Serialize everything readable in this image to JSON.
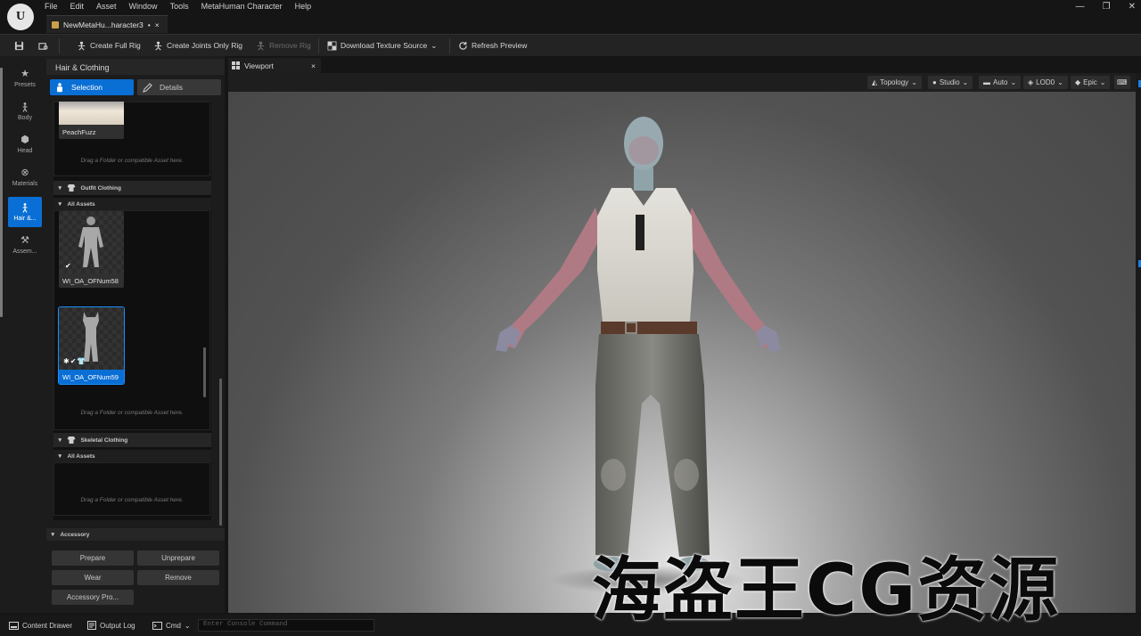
{
  "app": {
    "title": "NewMetaHu...haracter3",
    "tab_suffix": "•",
    "tab_close": "×",
    "logo_text": "U"
  },
  "menu": [
    "File",
    "Edit",
    "Asset",
    "Window",
    "Tools",
    "MetaHuman Character",
    "Help"
  ],
  "window_controls": [
    "—",
    "❐",
    "✕"
  ],
  "toolbar": {
    "create_full_rig": "Create Full Rig",
    "create_joints_only_rig": "Create Joints Only Rig",
    "remove_rig": "Remove Rig",
    "download_texture_source": "Download Texture Source",
    "refresh_preview": "Refresh Preview"
  },
  "sidebar": {
    "items": [
      {
        "label": "Presets",
        "icon": "star-icon",
        "glyph": "★"
      },
      {
        "label": "Body",
        "icon": "body-icon",
        "glyph": "🯅"
      },
      {
        "label": "Head",
        "icon": "head-icon",
        "glyph": "⬢"
      },
      {
        "label": "Materials",
        "icon": "materials-icon",
        "glyph": "⊗"
      },
      {
        "label": "Hair &...",
        "icon": "hair-clothing-icon",
        "glyph": "🯅"
      },
      {
        "label": "Assem...",
        "icon": "hammer-icon",
        "glyph": "⚒"
      }
    ]
  },
  "panel": {
    "title": "Hair & Clothing",
    "mode_selection": "Selection",
    "mode_details": "Details",
    "peach_fuzz": "PeachFuzz",
    "drag_hint": "Drag a Folder or compatible Asset here.",
    "outfit_clothing": "Outfit Clothing",
    "all_assets": "All Assets",
    "outfit_tiles": [
      "WI_OA_OFNum58",
      "WI_OA_OFNum59"
    ],
    "skeletal_clothing": "Skeletal Clothing",
    "accessory": "Accessory",
    "accessory_buttons": [
      "Prepare",
      "Unprepare",
      "Wear",
      "Remove",
      "Accessory Pro..."
    ]
  },
  "viewport": {
    "tab_label": "Viewport",
    "tab_close": "×",
    "topology": "Topology",
    "studio": "Studio",
    "auto": "Auto",
    "lod": "LOD0",
    "quality": "Epic",
    "caret": "⌄"
  },
  "statusbar": {
    "content_drawer": "Content Drawer",
    "output_log": "Output Log",
    "cmd": "Cmd",
    "console_placeholder": "Enter Console Command"
  },
  "watermark": "海盗王CG资源",
  "colors": {
    "accent": "#0a6fd4",
    "background": "#151515",
    "panel": "#1c1c1c",
    "gold": "#d9a521"
  }
}
